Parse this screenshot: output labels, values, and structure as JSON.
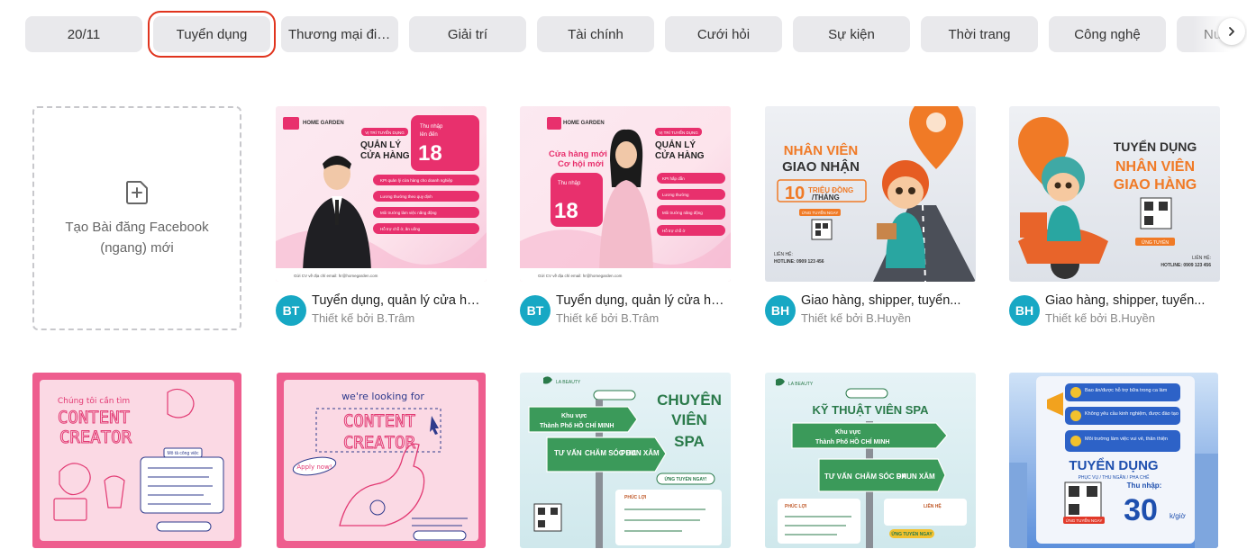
{
  "categories": [
    {
      "label": "20/11",
      "active": false
    },
    {
      "label": "Tuyển dụng",
      "active": true
    },
    {
      "label": "Thương mại điệ...",
      "active": false
    },
    {
      "label": "Giải trí",
      "active": false
    },
    {
      "label": "Tài chính",
      "active": false
    },
    {
      "label": "Cưới hỏi",
      "active": false
    },
    {
      "label": "Sự kiện",
      "active": false
    },
    {
      "label": "Thời trang",
      "active": false
    },
    {
      "label": "Công nghệ",
      "active": false
    },
    {
      "label": "Nư",
      "active": false
    }
  ],
  "create_card": {
    "label": "Tạo Bài đăng Facebook (ngang) mới"
  },
  "templates": [
    {
      "title": "Tuyển dụng, quản lý cửa hàn...",
      "author": "Thiết kế bởi B.Trâm",
      "avatar": "BT",
      "art": {
        "brand": "HOME GARDEN",
        "tag": "VỊ TRÍ TUYỂN DỤNG",
        "heading": "QUẢN LÝ CỬA HÀNG",
        "salary_label": "Thu nhập lên đến",
        "salary": "18",
        "salary_unit": "triệu",
        "benefits": [
          "KPI quản lý cửa hàng cho doanh nghiệp",
          "Lương thưởng theo quy định",
          "Môi trường làm việc năng động",
          "Hỗ trợ chỗ ở, ăn uống"
        ],
        "footer": "Gửi CV về địa chỉ email: hr@homegarden.com"
      }
    },
    {
      "title": "Tuyển dụng, quản lý cửa hàn...",
      "author": "Thiết kế bởi B.Trâm",
      "avatar": "BT",
      "art": {
        "brand": "HOME GARDEN",
        "tag": "VỊ TRÍ TUYỂN DỤNG",
        "heading": "QUẢN LÝ CỬA HÀNG",
        "subheading": "Cửa hàng mới Cơ hội mới",
        "salary_label": "Thu nhập lên đến",
        "salary": "18",
        "salary_unit": "triệu",
        "benefits": [
          "KPI hấp dẫn",
          "Lương thưởng",
          "Môi trường năng động",
          "Hỗ trợ chỗ ở"
        ],
        "footer": "Gửi CV về địa chỉ email: hr@homegarden.com"
      }
    },
    {
      "title": "Giao hàng, shipper, tuyển...",
      "author": "Thiết kế bởi B.Huyền",
      "avatar": "BH",
      "art": {
        "line1": "NHÂN VIÊN",
        "line2": "GIAO NHẬN",
        "salary_label": "THU NHẬP LÊN TỚI",
        "salary": "10",
        "salary_unit": "TRIỆU ĐỒNG",
        "per": "/THÁNG",
        "cta": "ỨNG TUYỂN NGAY",
        "contact_label": "LIÊN HỆ:",
        "hotline": "HOTLINE: 0909 123 456"
      }
    },
    {
      "title": "Giao hàng, shipper, tuyển...",
      "author": "Thiết kế bởi B.Huyền",
      "avatar": "BH",
      "art": {
        "line1": "TUYỂN DỤNG",
        "line2": "NHÂN VIÊN",
        "line3": "GIAO HÀNG",
        "cta": "ỨNG TUYỂN",
        "contact_label": "LIÊN HỆ:",
        "hotline": "HOTLINE: 0909 123 456"
      }
    },
    {
      "title": "",
      "author": "",
      "art": {
        "line0": "Chúng tôi cần tìm",
        "line1": "CONTENT",
        "line2": "CREATOR",
        "box_title": "Mô tả công việc"
      }
    },
    {
      "title": "",
      "author": "",
      "art": {
        "line0": "we're looking for",
        "line1": "CONTENT",
        "line2": "CREATOR",
        "badge": "Apply now!"
      }
    },
    {
      "title": "",
      "author": "",
      "art": {
        "brand": "LA BEAUTY",
        "line1": "CHUYÊN",
        "line2": "VIÊN",
        "line3": "SPA",
        "sign1": "Khu vực",
        "sign2": "Thành Phố HỒ CHÍ MINH",
        "opt1": "TƯ VẤN",
        "opt2": "CHĂM SÓC DA",
        "opt3": "PHUN XĂM",
        "cta": "ỨNG TUYỂN NGAY!",
        "benefit_title": "PHÚC LỢI"
      }
    },
    {
      "title": "",
      "author": "",
      "art": {
        "brand": "LA BEAUTY",
        "heading": "KỸ THUẬT VIÊN SPA",
        "sign1": "Khu vực",
        "sign2": "Thành Phố HỒ CHÍ MINH",
        "opt1": "TƯ VẤN",
        "opt2": "CHĂM SÓC DA",
        "opt3": "PHUN XĂM",
        "cta": "ỨNG TUYỂN NGAY",
        "benefit_title": "PHÚC LỢI",
        "contact": "LIÊN HỆ"
      }
    },
    {
      "title": "",
      "author": "",
      "art": {
        "b1": "Bao ăn/được hỗ trợ bữa trong ca làm",
        "b2": "Không yêu cầu kinh nghiệm, được đào tạo",
        "b3": "Môi trường làm việc vui vẻ, thân thiện",
        "heading": "TUYỂN DỤNG",
        "sub": "PHỤC VỤ / THU NGÂN / PHA CHẾ",
        "salary_label": "Thu nhập:",
        "salary": "30",
        "salary_unit": "k/giờ",
        "cta": "ỨNG TUYỂN NGAY"
      }
    }
  ]
}
